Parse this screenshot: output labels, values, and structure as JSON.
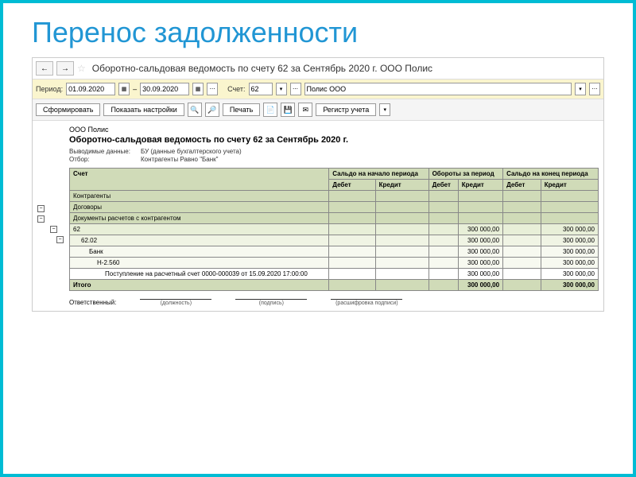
{
  "title": "Перенос задолженности",
  "nav": {
    "back": "←",
    "forward": "→"
  },
  "doc_title": "Оборотно-сальдовая ведомость по счету 62 за Сентябрь 2020 г. ООО Полис",
  "params": {
    "period_label": "Период:",
    "date_from": "01.09.2020",
    "date_to": "30.09.2020",
    "dash": "–",
    "account_label": "Счет:",
    "account": "62",
    "org": "Полис ООО"
  },
  "toolbar": {
    "generate": "Сформировать",
    "show_settings": "Показать настройки",
    "print": "Печать",
    "register": "Регистр учета"
  },
  "report": {
    "org": "ООО Полис",
    "title": "Оборотно-сальдовая ведомость по счету 62 за Сентябрь 2020 г.",
    "meta1_label": "Выводимые данные:",
    "meta1_val": "БУ (данные бухгалтерского учета)",
    "meta2_label": "Отбор:",
    "meta2_val": "Контрагенты Равно \"Банк\""
  },
  "headers": {
    "col1_r1": "Счет",
    "col1_r2": "Контрагенты",
    "col1_r3": "Договоры",
    "col1_r4": "Документы расчетов с контрагентом",
    "group1": "Сальдо на начало периода",
    "group2": "Обороты за период",
    "group3": "Сальдо на конец периода",
    "debit": "Дебет",
    "credit": "Кредит"
  },
  "rows": [
    {
      "cls": "row-main",
      "label": "62",
      "vals": [
        "",
        "",
        "",
        "300 000,00",
        "",
        "300 000,00"
      ]
    },
    {
      "cls": "row-sub1",
      "label": "62.02",
      "indent": 1,
      "vals": [
        "",
        "",
        "",
        "300 000,00",
        "",
        "300 000,00"
      ]
    },
    {
      "cls": "row-sub2",
      "label": "Банк",
      "indent": 2,
      "vals": [
        "",
        "",
        "",
        "300 000,00",
        "",
        "300 000,00"
      ]
    },
    {
      "cls": "row-sub2",
      "label": "Н-2.560",
      "indent": 3,
      "vals": [
        "",
        "",
        "",
        "300 000,00",
        "",
        "300 000,00"
      ]
    },
    {
      "cls": "row-doc",
      "label": "Поступление на расчетный счет 0000-000039 от 15.09.2020 17:00:00",
      "indent": 4,
      "vals": [
        "",
        "",
        "",
        "300 000,00",
        "",
        "300 000,00"
      ]
    },
    {
      "cls": "row-total",
      "label": "Итого",
      "vals": [
        "",
        "",
        "",
        "300 000,00",
        "",
        "300 000,00"
      ]
    }
  ],
  "signer": {
    "label": "Ответственный:",
    "s1": "(должность)",
    "s2": "(подпись)",
    "s3": "(расшифровка подписи)"
  }
}
